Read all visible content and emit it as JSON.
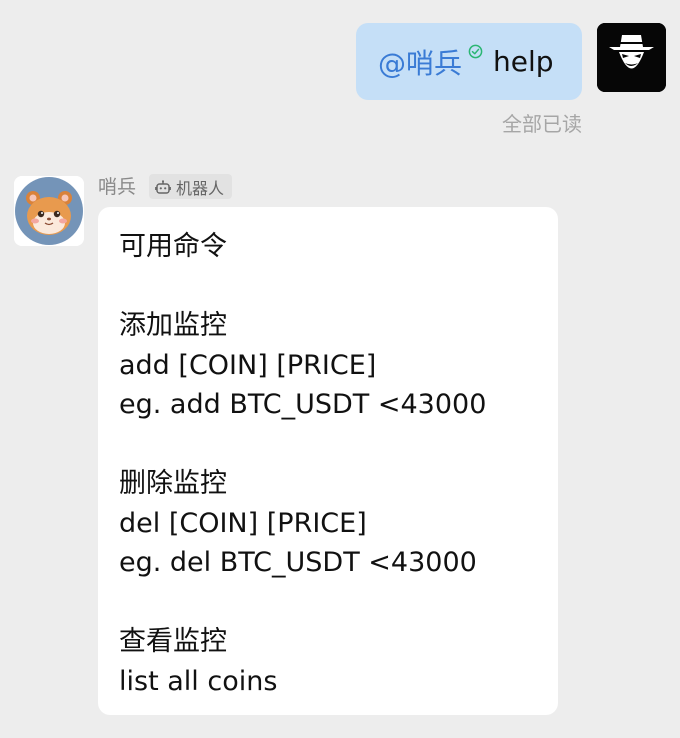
{
  "outgoing": {
    "mention": "@哨兵",
    "text": "help",
    "read_status": "全部已读"
  },
  "incoming": {
    "sender_name": "哨兵",
    "badge_label": "机器人",
    "lines": {
      "l1": "可用命令",
      "l2": "添加监控",
      "l3": "add [COIN] [PRICE]",
      "l4": "eg. add BTC_USDT <43000",
      "l5": "删除监控",
      "l6": "del [COIN] [PRICE]",
      "l7": "eg. del BTC_USDT <43000",
      "l8": "查看监控",
      "l9": "list all coins"
    }
  },
  "icons": {
    "verified": "check-circle-icon",
    "bot": "robot-icon",
    "user_avatar": "masked-figure-avatar",
    "bot_avatar": "hamster-avatar"
  },
  "colors": {
    "background": "#ededed",
    "outgoing_bubble": "#c5dff7",
    "incoming_bubble": "#ffffff",
    "mention": "#3a7bd5",
    "verified_check": "#2bb673"
  }
}
